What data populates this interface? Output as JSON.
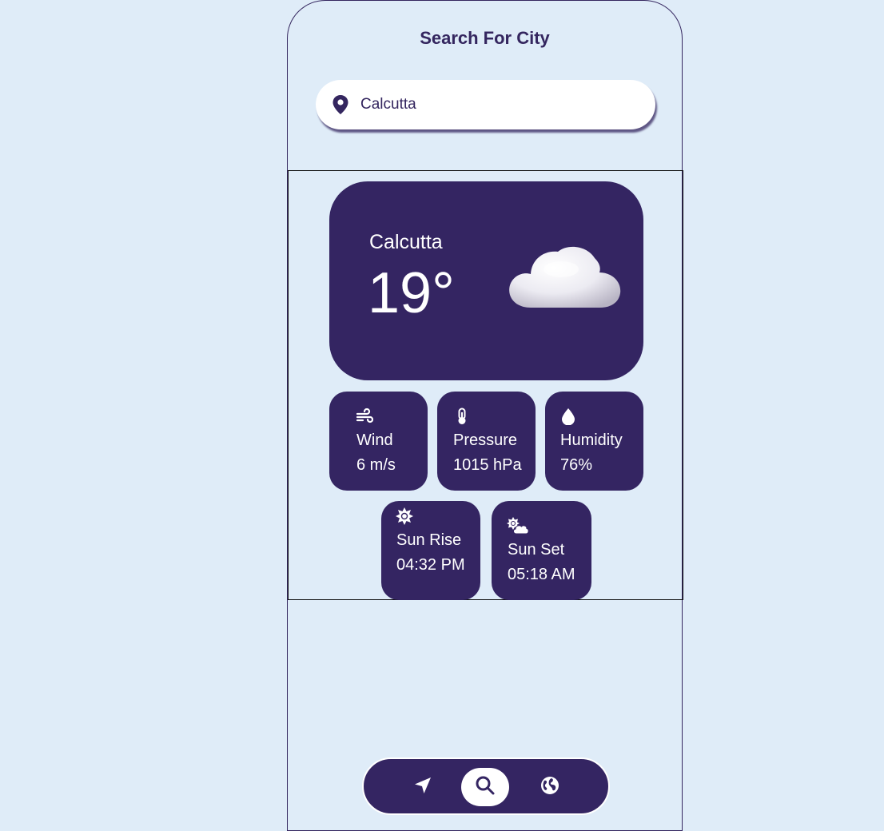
{
  "header": {
    "title": "Search For City"
  },
  "search": {
    "value": "Calcutta",
    "icon": "location-pin-icon"
  },
  "weather": {
    "city": "Calcutta",
    "temperature": "19°",
    "condition_icon": "cloud-icon"
  },
  "stats": [
    {
      "icon": "wind-icon",
      "label": "Wind",
      "value": "6 m/s"
    },
    {
      "icon": "thermometer-icon",
      "label": "Pressure",
      "value": "1015 hPa"
    },
    {
      "icon": "droplet-icon",
      "label": "Humidity",
      "value": "76%"
    }
  ],
  "sun": [
    {
      "icon": "sun-icon",
      "label": "Sun Rise",
      "value": "04:32 PM"
    },
    {
      "icon": "sun-cloud-icon",
      "label": "Sun Set",
      "value": "05:18 AM"
    }
  ],
  "nav": {
    "items": [
      {
        "icon": "location-arrow-icon",
        "active": false
      },
      {
        "icon": "search-icon",
        "active": true
      },
      {
        "icon": "globe-icon",
        "active": false
      }
    ]
  },
  "colors": {
    "background": "#dfecf8",
    "primary": "#342562",
    "text_on_primary": "#ffffff"
  }
}
